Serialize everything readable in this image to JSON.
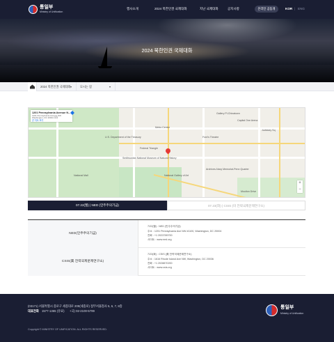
{
  "header": {
    "logo": "통일부",
    "logo_sub": "Ministry of Unification",
    "nav": [
      "행사소개",
      "2024 북한인권 국제대화",
      "지난 국제대화",
      "공지사항"
    ],
    "apply_button": "온라인 공동개",
    "lang_kor": "KOR",
    "lang_sep": "|",
    "lang_eng": "ENG"
  },
  "hero": {
    "title": "2024 북한인권 국제대화"
  },
  "breadcrumb": {
    "item1": "2024 북한인권 국제대화",
    "item2": "오시는 길"
  },
  "map": {
    "place_name": "1201 Pennsylvania Avenue N...",
    "place_addr": "1201 Pennsylvania Avenue NW Washington, DC 20004 미국",
    "place_link": "큰 지도 보기",
    "labels": [
      "Gallery Pl-Chinatown",
      "Metro Center",
      "Ford's Theatre",
      "Judiciary Sq",
      "Smithsonian National Museum of Natural History",
      "National Gallery of Art",
      "Archives-Navy Memorial-Penn Quarter",
      "National Mall",
      "Capital One Arena",
      "U.S. Department of the Treasury",
      "Federal Triangle",
      "Moulton Drive"
    ],
    "zoom_in": "+",
    "zoom_out": "−"
  },
  "tabs": [
    "07.22(월) | NED (민주주의기금)",
    "07.23(화) | CSIS (미 전략국제문제연구소)"
  ],
  "venues": [
    {
      "name": "NED(민주주의기금)",
      "lines": [
        "7/22(월) : NED (민주주의기금)",
        "주소 : 1201 Pennsylvania Ave NW #1100, Washington, DC 20004",
        "전화 : +1 2023789700",
        "사이트 : www.ned.org"
      ]
    },
    {
      "name": "CSIS(美 전략국제문제연구소)",
      "lines": [
        "7/23(화) : CSIS (美 전략국제문제연구소)",
        "주소 : 1616 Rhode Island Ave NW, Washington, DC 20036",
        "전화 : +1 2028870200",
        "사이트 : www.csis.org"
      ]
    }
  ],
  "footer": {
    "address": "(03171) 서울특별시 종로구 세종대로 209(세종로) 정부서울청사 5, 6, 7, 8층",
    "phone_label": "대표전화",
    "phone": "1577-1365 (유료)",
    "fax": "+국) 02-2100-5799",
    "copyright": "Copyright © MINISTRY OF UNIFICATION. ALL RIGHTS RESERVED.",
    "logo": "통일부",
    "logo_sub": "Ministry of Unification"
  },
  "colors": {
    "header_bg": "#1a1e33",
    "tab_active": "#1a1e33",
    "accent_red": "#e53935"
  }
}
